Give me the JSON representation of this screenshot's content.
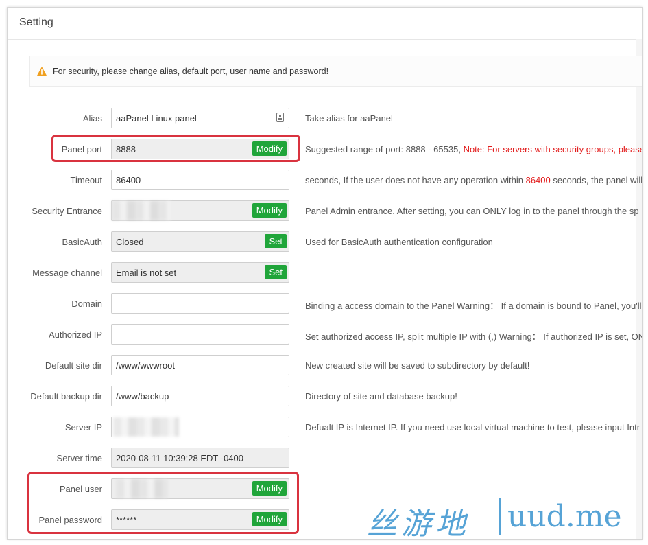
{
  "title": "Setting",
  "notice": "For security, please change alias, default port, user name and password!",
  "rows": [
    {
      "label": "Alias",
      "value": "aaPanel Linux panel",
      "desc": "Take alias for aaPanel"
    },
    {
      "label": "Panel port",
      "value": "8888",
      "button": "Modify",
      "desc": "Suggested range of port: 8888 - 65535, ",
      "desc_red": "Note: For servers with security groups, please"
    },
    {
      "label": "Timeout",
      "value": "86400",
      "desc": "seconds, If the user does not have any operation within ",
      "desc_red": "86400",
      "desc_tail": " seconds, the panel will"
    },
    {
      "label": "Security Entrance",
      "button": "Modify",
      "desc": "Panel Admin entrance. After setting, you can ONLY log in to the panel through the sp"
    },
    {
      "label": "BasicAuth",
      "value": "Closed",
      "button": "Set",
      "desc": "Used for BasicAuth authentication configuration"
    },
    {
      "label": "Message channel",
      "value": "Email is not set",
      "button": "Set",
      "desc": ""
    },
    {
      "label": "Domain",
      "value": "",
      "desc": "Binding a access domain to the Panel Warning： If a domain is bound to Panel, you'll"
    },
    {
      "label": "Authorized IP",
      "value": "",
      "desc": "Set authorized access IP, split multiple IP with (,) Warning： If authorized IP is set, ONL"
    },
    {
      "label": "Default site dir",
      "value": "/www/wwwroot",
      "desc": "New created site will be saved to subdirectory by default!"
    },
    {
      "label": "Default backup dir",
      "value": "/www/backup",
      "desc": "Directory of site and database backup!"
    },
    {
      "label": "Server IP",
      "desc": "Defualt IP is Internet IP. If you need use local virtual machine to test, please input Intr"
    },
    {
      "label": "Server time",
      "value": "2020-08-11 10:39:28 EDT -0400",
      "desc": ""
    },
    {
      "label": "Panel user",
      "button": "Modify",
      "desc": ""
    },
    {
      "label": "Panel password",
      "value": "******",
      "button": "Modify",
      "desc": ""
    }
  ],
  "watermark": {
    "cn": "丝游地",
    "en": "uud.me"
  },
  "colors": {
    "accent": "#20a53a",
    "highlight": "#d9333f",
    "warning": "#f0a020",
    "watermark": "#56a3d6"
  }
}
